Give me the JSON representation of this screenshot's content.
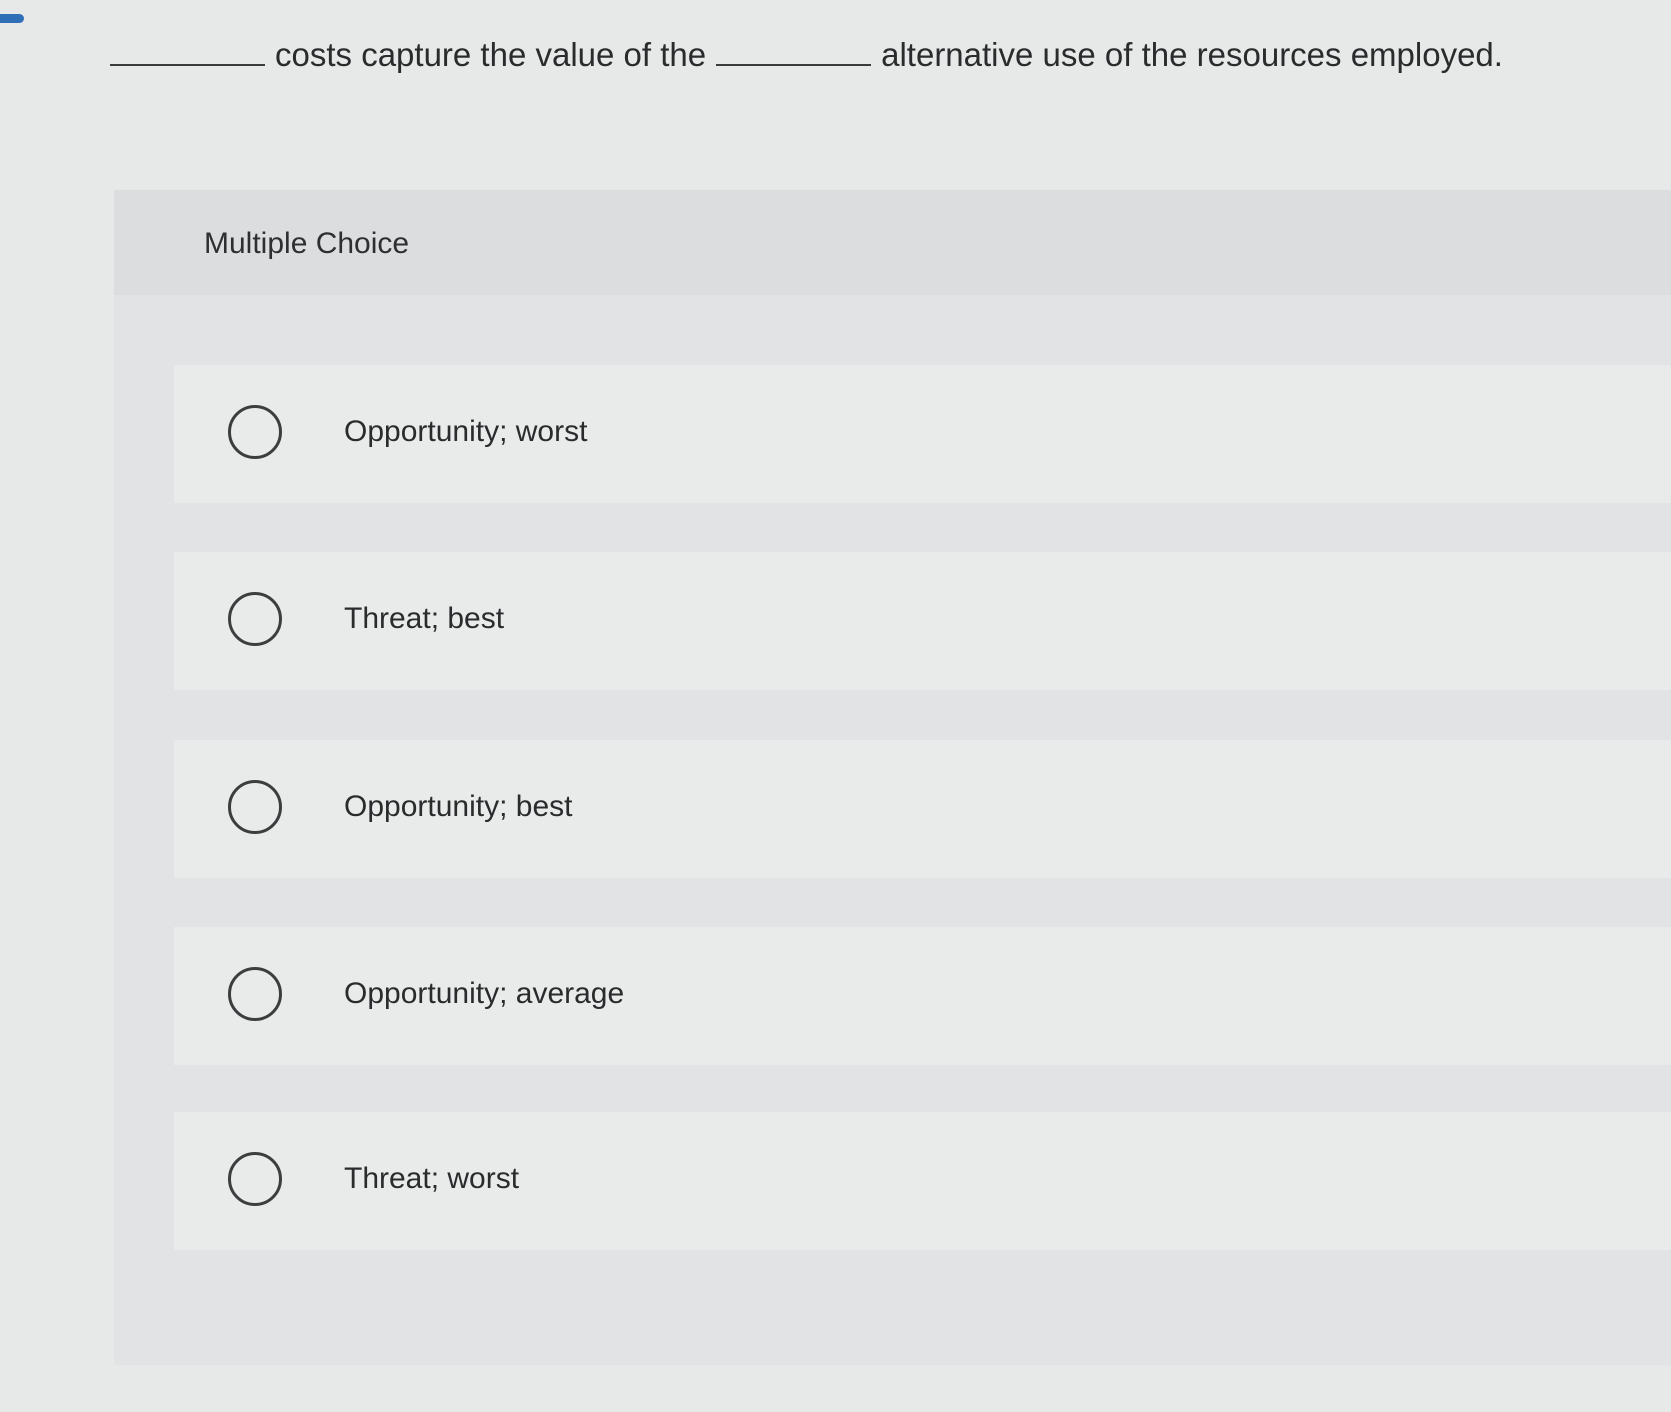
{
  "question": {
    "part1": "costs capture the value of the",
    "part2": "alternative use of the resources employed."
  },
  "multiple_choice": {
    "title": "Multiple Choice",
    "options": [
      {
        "label": "Opportunity; worst"
      },
      {
        "label": "Threat; best"
      },
      {
        "label": "Opportunity; best"
      },
      {
        "label": "Opportunity; average"
      },
      {
        "label": "Threat; worst"
      }
    ]
  },
  "colors": {
    "accent": "#2f6fb8",
    "page_background": "#e7e8e8",
    "panel_background": "#e2e3e4",
    "option_background": "#e9eaea",
    "text": "#2a2b2d"
  }
}
